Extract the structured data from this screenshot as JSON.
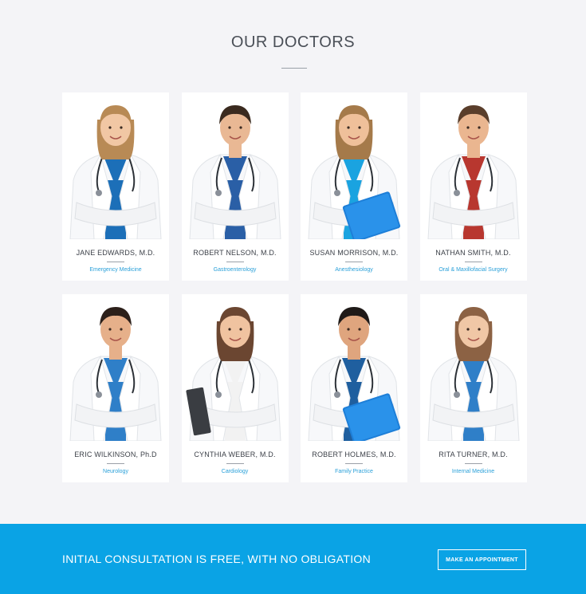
{
  "section": {
    "title": "OUR DOCTORS"
  },
  "doctors": [
    {
      "name": "JANE EDWARDS, M.D.",
      "specialty": "Emergency Medicine",
      "gender": "f",
      "hair": "#b88a55",
      "scrub": "#1c6fb8",
      "skin": "#f1c7a4",
      "prop": "none"
    },
    {
      "name": "ROBERT NELSON, M.D.",
      "specialty": "Gastroenterology",
      "gender": "m",
      "hair": "#3a2a1f",
      "scrub": "#2a5fa6",
      "skin": "#e9b894",
      "prop": "none"
    },
    {
      "name": "SUSAN MORRISON, M.D.",
      "specialty": "Anesthesiology",
      "gender": "f",
      "hair": "#a57a4a",
      "scrub": "#1aa3e0",
      "skin": "#efc09a",
      "prop": "folder"
    },
    {
      "name": "NATHAN SMITH, M.D.",
      "specialty": "Oral & Maxillofacial Surgery",
      "gender": "m",
      "hair": "#5a3e2b",
      "scrub": "#b8372f",
      "skin": "#eab690",
      "prop": "none"
    },
    {
      "name": "ERIC WILKINSON, Ph.D",
      "specialty": "Neurology",
      "gender": "m",
      "hair": "#2c201a",
      "scrub": "#2f7fc8",
      "skin": "#e6b08a",
      "prop": "none"
    },
    {
      "name": "CYNTHIA WEBER, M.D.",
      "specialty": "Cardiology",
      "gender": "f",
      "hair": "#6b4631",
      "scrub": "#f2f2f2",
      "skin": "#f0c3a0",
      "prop": "clipboard"
    },
    {
      "name": "ROBERT HOLMES, M.D.",
      "specialty": "Family Practice",
      "gender": "m",
      "hair": "#1f1a18",
      "scrub": "#1f5f9f",
      "skin": "#dfa57e",
      "prop": "folder"
    },
    {
      "name": "RITA TURNER, M.D.",
      "specialty": "Internal Medicine",
      "gender": "f",
      "hair": "#8c6244",
      "scrub": "#2f7fc8",
      "skin": "#f0c7a6",
      "prop": "none"
    }
  ],
  "banner": {
    "text": "INITIAL CONSULTATION IS FREE, WITH NO OBLIGATION",
    "button_label": "MAKE AN APPOINTMENT"
  },
  "colors": {
    "accent": "#0aa3e5",
    "specialty_text": "#2aa0d9",
    "background": "#f4f4f7"
  }
}
